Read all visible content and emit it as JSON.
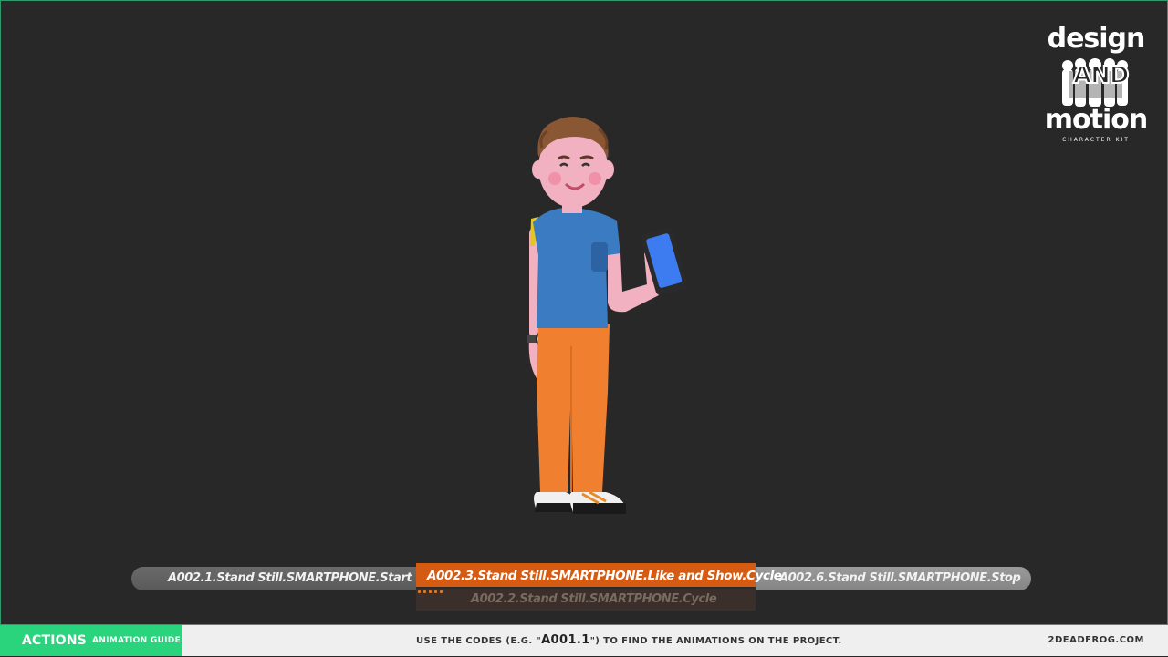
{
  "logo": {
    "line1": "design",
    "line2": "AND",
    "line3": "motion",
    "subtitle": "CHARACTER KIT"
  },
  "timeline": {
    "prev_clip": "A002.1.Stand Still.SMARTPHONE.Start",
    "current_clip": "A002.3.Stand Still.SMARTPHONE.Like and Show.Cycle",
    "next_clip": "A002.6.Stand Still.SMARTPHONE.Stop",
    "queued_clip": "A002.2.Stand Still.SMARTPHONE.Cycle"
  },
  "footer": {
    "tag": "ACTIONS",
    "tag_small": "ANIMATION GUIDE",
    "message_before": "USE THE CODES (E.G. \"",
    "message_code": "A001.1",
    "message_after": "\") TO FIND THE ANIMATIONS ON THE PROJECT.",
    "site": "2DEADFROG.COM"
  },
  "colors": {
    "background": "#282828",
    "accent_orange": "#d55a12",
    "accent_green": "#2ad47c",
    "shirt": "#3b7bc2",
    "pants": "#f08030",
    "skin": "#f3b3c3",
    "phone": "#3d7bf0"
  }
}
